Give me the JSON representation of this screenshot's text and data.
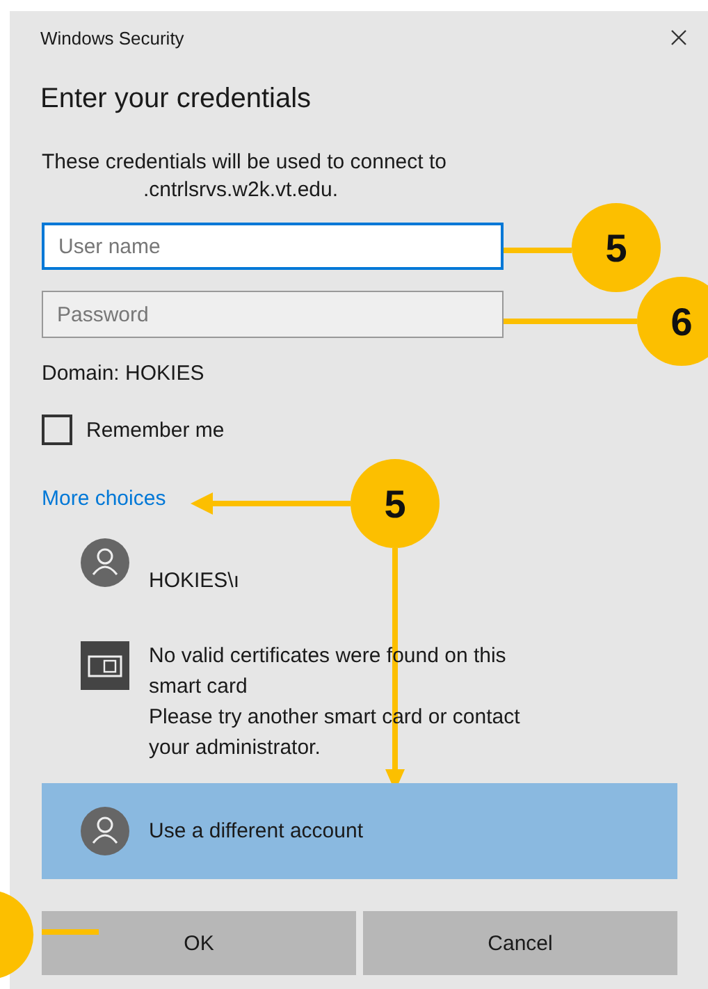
{
  "window": {
    "title": "Windows Security"
  },
  "heading": "Enter your credentials",
  "description": {
    "line_1": "These credentials will be used to connect to",
    "line_2": ".cntrlsrvs.w2k.vt.edu."
  },
  "fields": [
    {
      "placeholder": "User name",
      "focused": true
    },
    {
      "placeholder": "Password",
      "focused": false
    }
  ],
  "domain": "Domain: HOKIES",
  "remember_me": {
    "label": "Remember me",
    "checked": false
  },
  "more_choices": "More choices",
  "accounts": [
    {
      "kind": "user",
      "lines": [
        "HOKIES\\ı"
      ],
      "selected": false
    },
    {
      "kind": "smartcard",
      "lines": [
        "No valid certificates were found on this smart card",
        "Please try another smart card or contact your administrator."
      ],
      "selected": false
    },
    {
      "kind": "user",
      "lines": [
        "Use a different account"
      ],
      "selected": true
    }
  ],
  "buttons": [
    "OK",
    "Cancel"
  ],
  "annotations": [
    {
      "label": "5"
    },
    {
      "label": "6"
    },
    {
      "label": "5"
    }
  ]
}
